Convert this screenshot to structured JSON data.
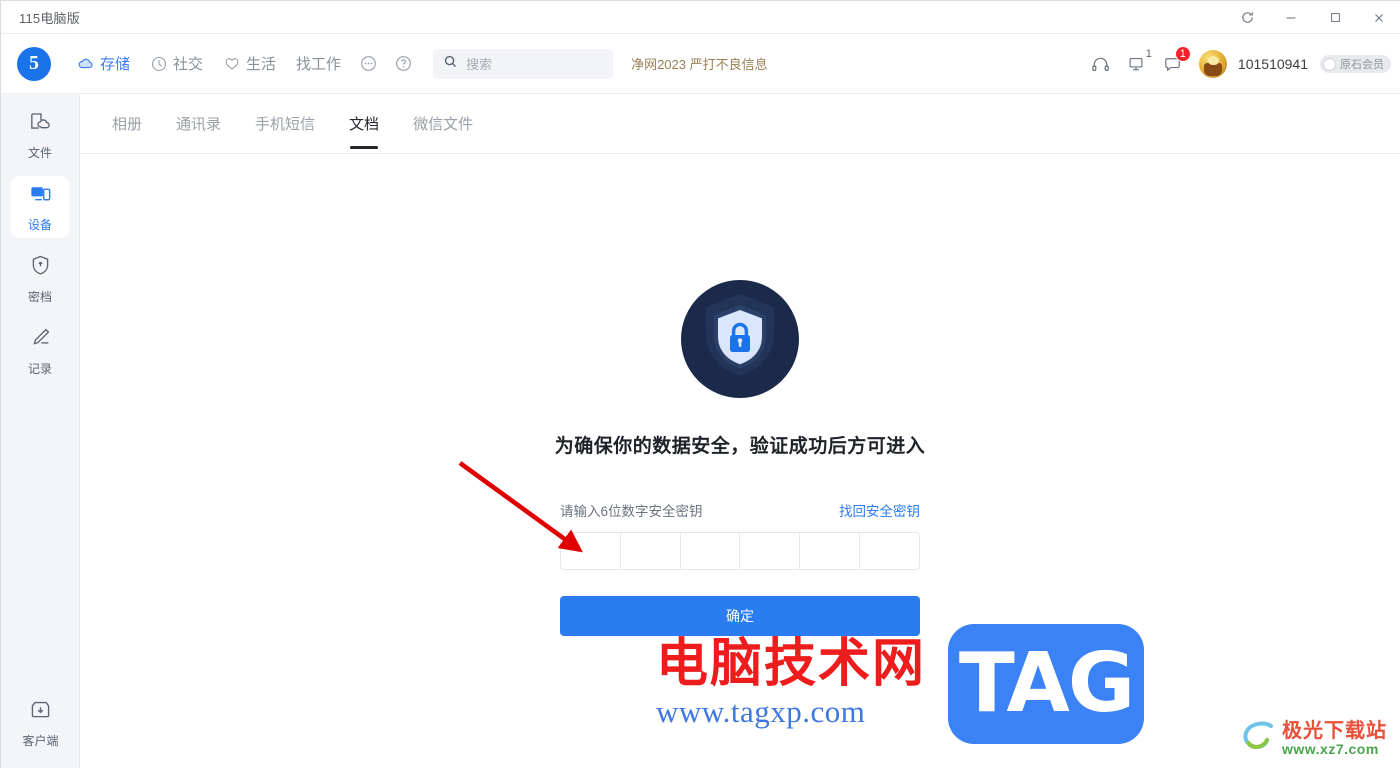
{
  "window": {
    "title": "115电脑版",
    "controls": [
      {
        "name": "refresh",
        "glyph": "refresh-icon"
      },
      {
        "name": "minimize",
        "glyph": "minimize-icon"
      },
      {
        "name": "maximize",
        "glyph": "maximize-icon"
      },
      {
        "name": "close",
        "glyph": "close-icon"
      }
    ]
  },
  "topnav": {
    "logo_text": "5",
    "items": [
      {
        "label": "存储",
        "icon": "cloud-icon",
        "active": true
      },
      {
        "label": "社交",
        "icon": "clock-icon",
        "active": false
      },
      {
        "label": "生活",
        "icon": "heart-icon",
        "active": false
      },
      {
        "label": "找工作",
        "icon": "",
        "active": false
      }
    ],
    "icon_buttons": [
      {
        "name": "more-icon"
      },
      {
        "name": "help-icon"
      }
    ],
    "search": {
      "placeholder": "搜索",
      "value": "",
      "icon": "search-icon"
    },
    "notice": "净网2023 严打不良信息",
    "right": {
      "headset_icon": "headset-icon",
      "monitor_icon": "monitor-icon",
      "monitor_count": "1",
      "message_icon": "message-icon",
      "message_count": "1",
      "username": "101510941",
      "vip_label": "原石会员"
    }
  },
  "sidebar": {
    "items": [
      {
        "label": "文件",
        "icon": "file-cloud-icon",
        "active": false
      },
      {
        "label": "设备",
        "icon": "devices-icon",
        "active": true
      },
      {
        "label": "密档",
        "icon": "shield-lock-icon",
        "active": false
      },
      {
        "label": "记录",
        "icon": "pencil-icon",
        "active": false
      }
    ],
    "bottom": {
      "label": "客户端",
      "icon": "download-box-icon"
    }
  },
  "tabs": [
    {
      "label": "相册",
      "active": false
    },
    {
      "label": "通讯录",
      "active": false
    },
    {
      "label": "手机短信",
      "active": false
    },
    {
      "label": "文档",
      "active": true
    },
    {
      "label": "微信文件",
      "active": false
    }
  ],
  "verify": {
    "shield_icon": "shield-lock-badge-icon",
    "title": "为确保你的数据安全，验证成功后方可进入",
    "code_label": "请输入6位数字安全密钥",
    "recover_link": "找回安全密钥",
    "code_cells": [
      "",
      "",
      "",
      "",
      "",
      ""
    ],
    "confirm_label": "确定"
  },
  "watermarks": {
    "main_cn": "电脑技术网",
    "main_url": "www.tagxp.com",
    "main_tag": "TAG",
    "corner_cn": "极光下载站",
    "corner_url": "www.xz7.com"
  },
  "colors": {
    "accent": "#2a7cf0",
    "badge_red": "#f5222d",
    "notice": "#9a7f56",
    "watermark_red": "#ee1c1c",
    "watermark_blue": "#3b82f6"
  }
}
